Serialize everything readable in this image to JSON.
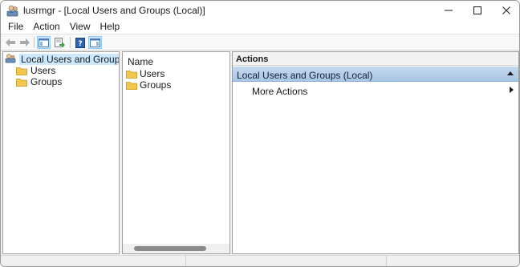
{
  "window": {
    "title": "lusrmgr - [Local Users and Groups (Local)]",
    "icon": "users-console-icon"
  },
  "caption_buttons": {
    "minimize": "minimize-icon",
    "maximize": "maximize-icon",
    "close": "close-icon"
  },
  "menu": {
    "items": [
      "File",
      "Action",
      "View",
      "Help"
    ]
  },
  "toolbar": {
    "buttons": [
      {
        "icon": "back-arrow-icon",
        "enabled": false
      },
      {
        "icon": "forward-arrow-icon",
        "enabled": false
      },
      {
        "icon": "show-hide-console-tree-icon",
        "pressed": true
      },
      {
        "icon": "export-list-icon"
      },
      {
        "icon": "help-icon"
      },
      {
        "icon": "show-hide-action-pane-icon",
        "pressed": true
      }
    ]
  },
  "tree": {
    "root": {
      "label": "Local Users and Groups (Local)",
      "icon": "users-console-icon",
      "selected": true
    },
    "children": [
      {
        "label": "Users",
        "icon": "folder-icon"
      },
      {
        "label": "Groups",
        "icon": "folder-icon"
      }
    ]
  },
  "list": {
    "columns": [
      "Name"
    ],
    "rows": [
      {
        "label": "Users",
        "icon": "folder-icon"
      },
      {
        "label": "Groups",
        "icon": "folder-icon"
      }
    ]
  },
  "actions": {
    "title": "Actions",
    "group_label": "Local Users and Groups (Local)",
    "items": [
      {
        "label": "More Actions"
      }
    ]
  },
  "colors": {
    "actions_group_bg": "#b6cfea",
    "selection_bg": "#cce8ff",
    "folder_yellow": "#f3c74e"
  }
}
